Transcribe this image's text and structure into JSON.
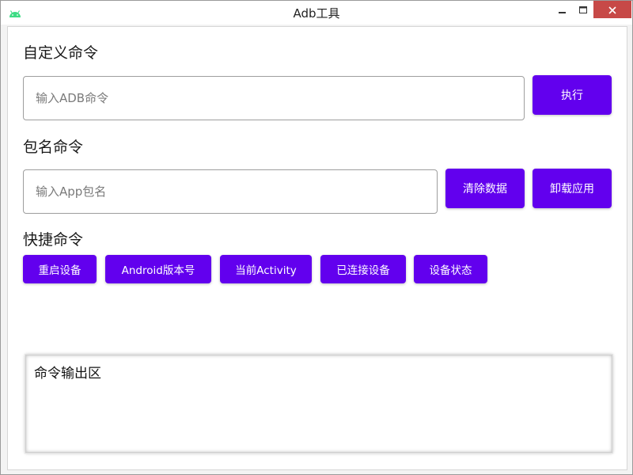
{
  "window": {
    "title": "Adb工具",
    "app_icon": "android-icon",
    "controls": {
      "minimize_icon": "minimize-icon",
      "maximize_icon": "maximize-icon",
      "close_icon": "close-icon"
    },
    "close_color": "#c74947"
  },
  "custom_command": {
    "title": "自定义命令",
    "input_placeholder": "输入ADB命令",
    "input_value": "",
    "execute_label": "执行"
  },
  "package_command": {
    "title": "包名命令",
    "input_placeholder": "输入App包名",
    "input_value": "",
    "clear_data_label": "清除数据",
    "uninstall_label": "卸载应用"
  },
  "quick_commands": {
    "title": "快捷命令",
    "buttons": [
      {
        "label": "重启设备"
      },
      {
        "label": "Android版本号"
      },
      {
        "label": "当前Activity"
      },
      {
        "label": "已连接设备"
      },
      {
        "label": "设备状态"
      }
    ]
  },
  "output": {
    "text": "命令输出区"
  },
  "colors": {
    "accent": "#6200ee",
    "button_text": "#ffffff"
  }
}
